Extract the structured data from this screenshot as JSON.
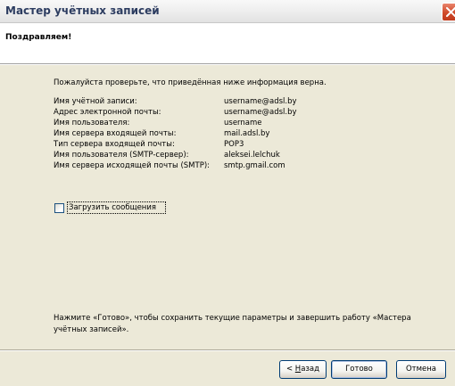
{
  "window": {
    "title": "Мастер учётных записей"
  },
  "header": {
    "title": "Поздравляем!"
  },
  "intro": "Пожалуйста проверьте, что приведённая ниже информация верна.",
  "info": [
    {
      "label": "Имя учётной записи:",
      "value": "username@adsl.by"
    },
    {
      "label": "Адрес электронной почты:",
      "value": "username@adsl.by"
    },
    {
      "label": "Имя пользователя:",
      "value": "username"
    },
    {
      "label": "Имя сервера входящей почты:",
      "value": "mail.adsl.by"
    },
    {
      "label": "Тип сервера входящей почты:",
      "value": "POP3"
    },
    {
      "label": "Имя пользователя (SMTP-сервер):",
      "value": "aleksei.lelchuk"
    },
    {
      "label": "Имя сервера исходящей почты (SMTP):",
      "value": "smtp.gmail.com"
    }
  ],
  "download_checkbox": {
    "label": "Загрузить сообщения",
    "checked": false
  },
  "finish_text": "Нажмите «Готово», чтобы сохранить текущие параметры и завершить работу «Мастера учётных записей».",
  "buttons": {
    "back_prefix": "< ",
    "back_key": "Н",
    "back_rest": "азад",
    "finish": "Готово",
    "cancel": "Отмена"
  },
  "icons": {
    "close": "close-icon"
  }
}
